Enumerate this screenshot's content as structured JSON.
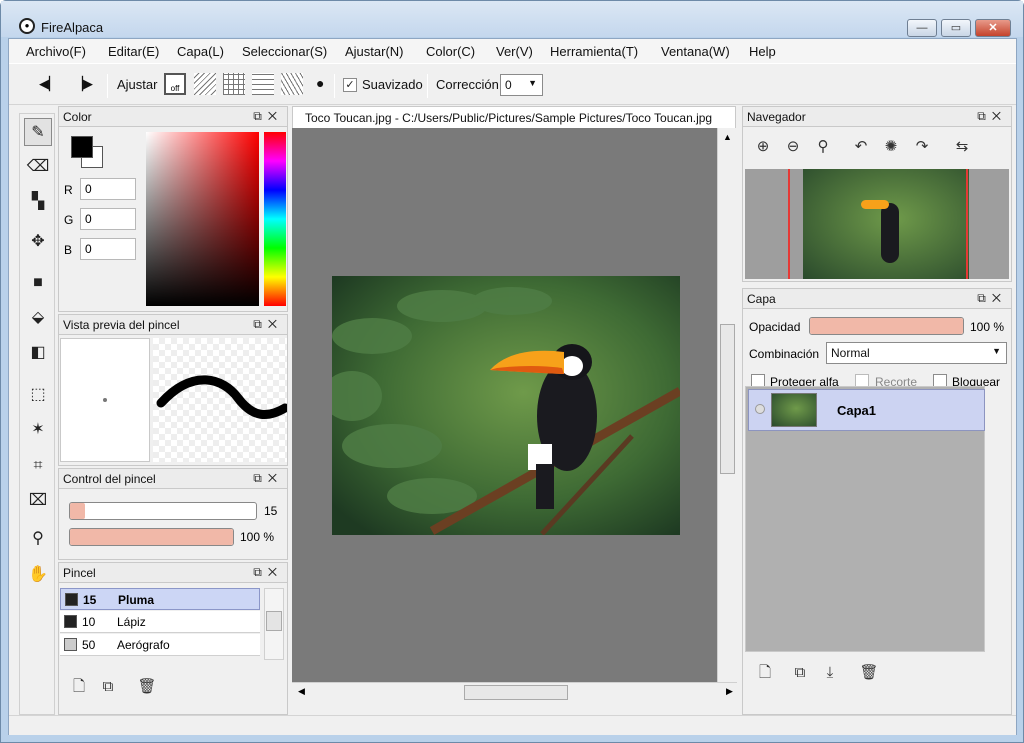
{
  "window": {
    "title": "FireAlpaca"
  },
  "menu": [
    "Archivo(F)",
    "Editar(E)",
    "Capa(L)",
    "Seleccionar(S)",
    "Ajustar(N)",
    "Color(C)",
    "Ver(V)",
    "Herramienta(T)",
    "Ventana(W)",
    "Help"
  ],
  "toolbar": {
    "ajustar_label": "Ajustar",
    "snap_off_label": "off",
    "suavizado_label": "Suavizado",
    "suavizado_checked": "✓",
    "correccion_label": "Corrección",
    "correccion_value": "0"
  },
  "color_panel": {
    "title": "Color",
    "r_label": "R",
    "g_label": "G",
    "b_label": "B",
    "r": "0",
    "g": "0",
    "b": "0"
  },
  "brush_preview_panel": {
    "title": "Vista previa del pincel"
  },
  "brush_control_panel": {
    "title": "Control del pincel",
    "size_value": "15",
    "opacity_value": "100 %",
    "size_fraction": 0.08,
    "opacity_fraction": 1.0
  },
  "brush_panel": {
    "title": "Pincel",
    "items": [
      {
        "size": "15",
        "name": "Pluma",
        "selected": true
      },
      {
        "size": "10",
        "name": "Lápiz",
        "selected": false
      },
      {
        "size": "50",
        "name": "Aerógrafo",
        "selected": false
      }
    ]
  },
  "document": {
    "tab_title": "Toco Toucan.jpg - C:/Users/Public/Pictures/Sample Pictures/Toco Toucan.jpg"
  },
  "navigator_panel": {
    "title": "Navegador"
  },
  "layer_panel": {
    "title": "Capa",
    "opacity_label": "Opacidad",
    "opacity_value": "100 %",
    "blend_label": "Combinación",
    "blend_value": "Normal",
    "protect_alpha_label": "Proteger alfa",
    "clipping_label": "Recorte",
    "lock_label": "Bloquear",
    "layers": [
      {
        "name": "Capa1"
      }
    ]
  },
  "colors": {
    "accent_slider": "#f1b8a8",
    "selected_row": "#ccd6f5",
    "canvas_bg": "#7a7a7a"
  }
}
